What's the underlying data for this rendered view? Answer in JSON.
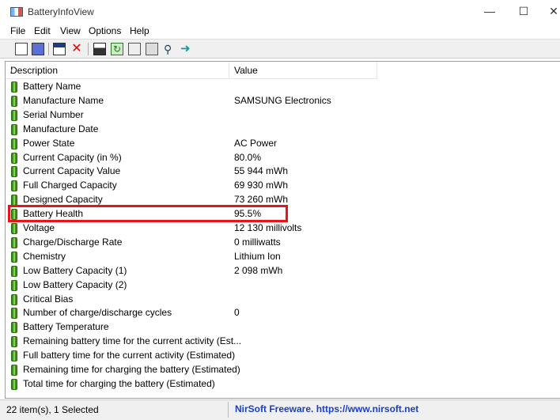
{
  "window": {
    "title": "BatteryInfoView"
  },
  "menu": [
    "File",
    "Edit",
    "View",
    "Options",
    "Help"
  ],
  "toolbar": [
    "properties-icon",
    "copy-report-icon",
    "html-report-icon",
    "delete-icon",
    "save-icon",
    "refresh-icon",
    "copy-icon",
    "advanced-options-icon",
    "find-icon",
    "exit-icon"
  ],
  "columns": {
    "description": "Description",
    "value": "Value",
    "sort_indicator": "/"
  },
  "rows": [
    {
      "desc": "Battery Name",
      "val": ""
    },
    {
      "desc": "Manufacture Name",
      "val": "SAMSUNG Electronics"
    },
    {
      "desc": "Serial Number",
      "val": ""
    },
    {
      "desc": "Manufacture Date",
      "val": ""
    },
    {
      "desc": "Power State",
      "val": "AC Power"
    },
    {
      "desc": "Current Capacity (in %)",
      "val": "80.0%"
    },
    {
      "desc": "Current Capacity Value",
      "val": "55 944 mWh"
    },
    {
      "desc": "Full Charged Capacity",
      "val": "69 930 mWh"
    },
    {
      "desc": "Designed Capacity",
      "val": "73 260 mWh"
    },
    {
      "desc": "Battery Health",
      "val": "95.5%"
    },
    {
      "desc": "Voltage",
      "val": "12 130 millivolts"
    },
    {
      "desc": "Charge/Discharge Rate",
      "val": "0 milliwatts"
    },
    {
      "desc": "Chemistry",
      "val": "Lithium Ion"
    },
    {
      "desc": "Low Battery Capacity (1)",
      "val": "2 098 mWh"
    },
    {
      "desc": "Low Battery Capacity (2)",
      "val": ""
    },
    {
      "desc": "Critical Bias",
      "val": ""
    },
    {
      "desc": "Number of charge/discharge cycles",
      "val": "0"
    },
    {
      "desc": "Battery Temperature",
      "val": ""
    },
    {
      "desc": "Remaining battery time for the current activity (Est...",
      "val": ""
    },
    {
      "desc": "Full battery time for the current activity (Estimated)",
      "val": ""
    },
    {
      "desc": "Remaining time for charging the battery (Estimated)",
      "val": ""
    },
    {
      "desc": "Total  time for charging the battery (Estimated)",
      "val": ""
    }
  ],
  "highlight_color": "#e8141b",
  "status": {
    "count": "22 item(s), 1 Selected",
    "link": "NirSoft Freeware. https://www.nirsoft.net"
  }
}
